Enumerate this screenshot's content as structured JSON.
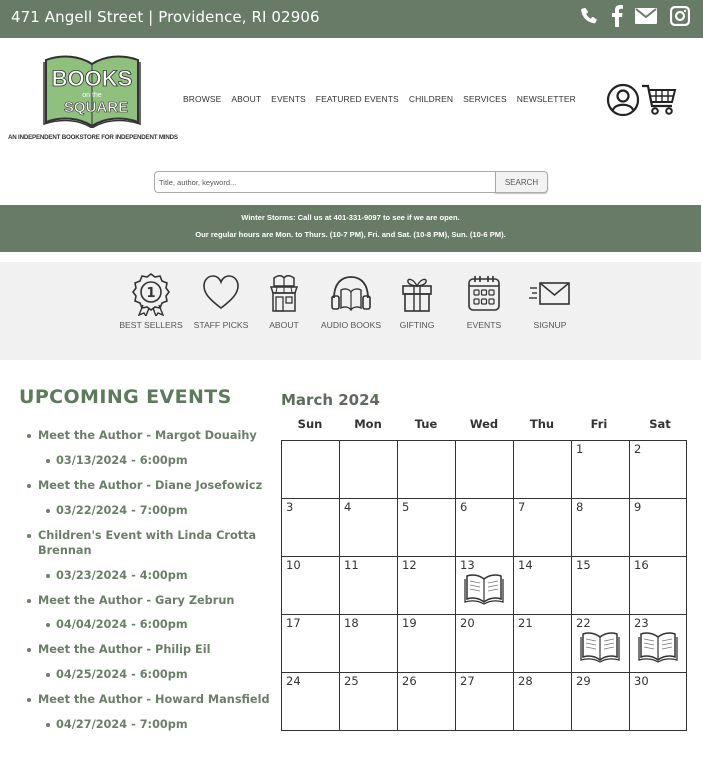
{
  "topbar": {
    "address": "471 Angell Street | Providence, RI 02906",
    "social": [
      {
        "icon": "phone-icon"
      },
      {
        "icon": "facebook-icon"
      },
      {
        "icon": "mail-icon"
      },
      {
        "icon": "instagram-icon"
      }
    ]
  },
  "logo": {
    "line1": "BOOKS",
    "line2": "on the",
    "line3": "SQUARE",
    "tagline": "AN INDEPENDENT BOOKSTORE FOR INDEPENDENT MINDS"
  },
  "nav": [
    "BROWSE",
    "ABOUT",
    "EVENTS",
    "FEATURED EVENTS",
    "CHILDREN",
    "SERVICES",
    "NEWSLETTER"
  ],
  "search": {
    "placeholder": "Title, author, keyword...",
    "button": "SEARCH"
  },
  "notice": {
    "line1": "Winter Storms: Call us at 401-331-9097 to see if we are open.",
    "line2": "Our regular hours are Mon. to Thurs. (10-7 PM), Fri. and Sat. (10-8 PM), Sun. (10-6 PM)."
  },
  "categories": [
    {
      "label": "BEST SELLERS",
      "icon": "award-ribbon-icon"
    },
    {
      "label": "STAFF PICKS",
      "icon": "heart-icon"
    },
    {
      "label": "ABOUT",
      "icon": "storefront-icon"
    },
    {
      "label": "AUDIO BOOKS",
      "icon": "headphones-book-icon"
    },
    {
      "label": "GIFTING",
      "icon": "gift-icon"
    },
    {
      "label": "EVENTS",
      "icon": "calendar-icon"
    },
    {
      "label": "SIGNUP",
      "icon": "envelope-send-icon"
    }
  ],
  "events": {
    "title": "UPCOMING EVENTS",
    "items": [
      {
        "name": "Meet the Author - Margot Douaihy",
        "date": "03/13/2024 - 6:00pm"
      },
      {
        "name": "Meet the Author - Diane Josefowicz",
        "date": "03/22/2024 - 7:00pm"
      },
      {
        "name": "Children's Event with Linda Crotta Brennan",
        "date": "03/23/2024 - 4:00pm"
      },
      {
        "name": "Meet the Author - Gary Zebrun",
        "date": "04/04/2024 - 6:00pm"
      },
      {
        "name": "Meet the Author - Philip Eil",
        "date": "04/25/2024 - 6:00pm"
      },
      {
        "name": "Meet the Author - Howard Mansfield",
        "date": "04/27/2024 - 7:00pm"
      }
    ]
  },
  "calendar": {
    "title": "March 2024",
    "weekdays": [
      "Sun",
      "Mon",
      "Tue",
      "Wed",
      "Thu",
      "Fri",
      "Sat"
    ],
    "weeks": [
      [
        "",
        "",
        "",
        "",
        "",
        "1",
        "2"
      ],
      [
        "3",
        "4",
        "5",
        "6",
        "7",
        "8",
        "9"
      ],
      [
        "10",
        "11",
        "12",
        "13",
        "14",
        "15",
        "16"
      ],
      [
        "17",
        "18",
        "19",
        "20",
        "21",
        "22",
        "23"
      ],
      [
        "24",
        "25",
        "26",
        "27",
        "28",
        "29",
        "30"
      ]
    ],
    "event_days": [
      "13",
      "22",
      "23"
    ]
  },
  "colors": {
    "brand_green": "#687b66",
    "event_text": "#6b7f68",
    "logo_green": "#8fc07e"
  }
}
